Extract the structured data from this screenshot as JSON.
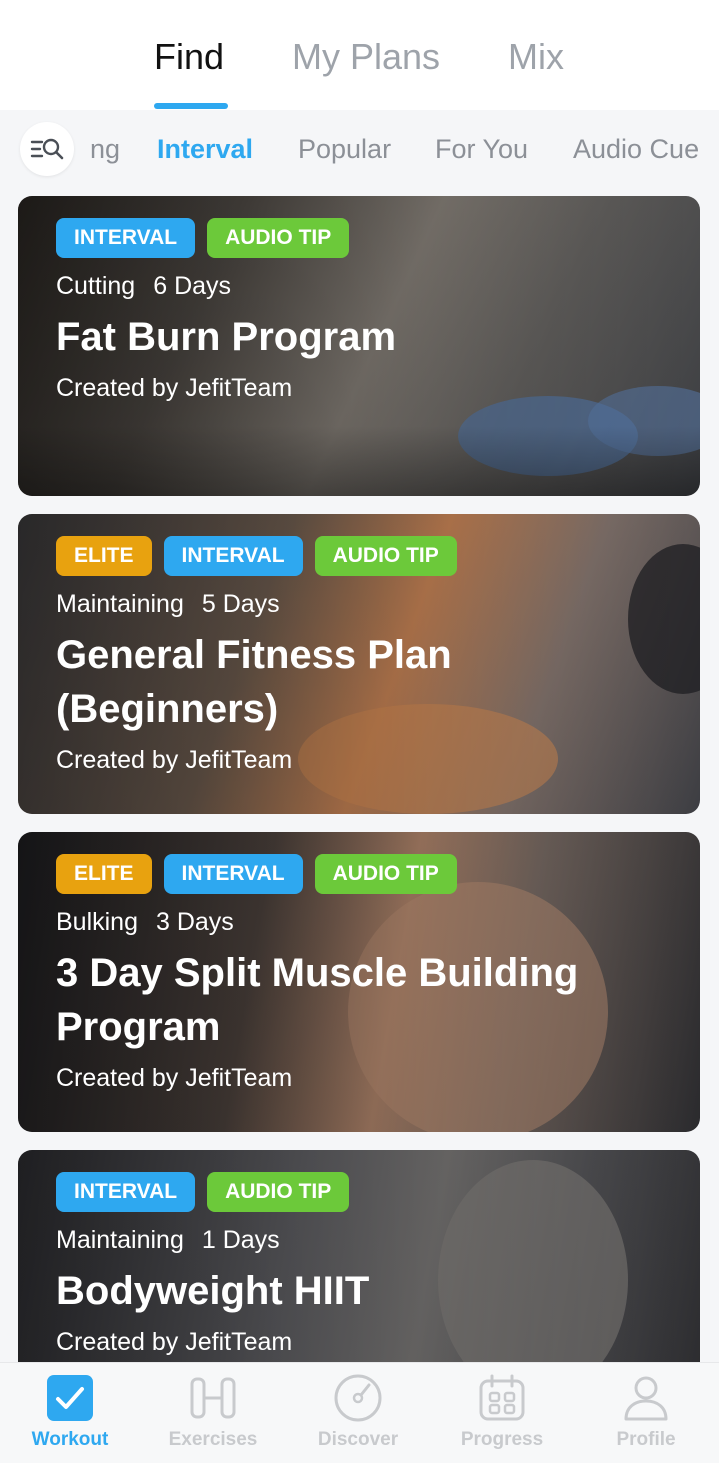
{
  "top_tabs": {
    "find": "Find",
    "my_plans": "My Plans",
    "mix": "Mix",
    "active": "Find"
  },
  "filters": {
    "search_icon": "search-filter-icon",
    "chips": [
      "ng",
      "Interval",
      "Popular",
      "For You",
      "Audio Cue"
    ],
    "active": "Interval"
  },
  "plans": [
    {
      "badges": [
        "INTERVAL",
        "AUDIO TIP"
      ],
      "goal": "Cutting",
      "duration": "6 Days",
      "title": "Fat Burn Program",
      "creator": "Created by JefitTeam"
    },
    {
      "badges": [
        "ELITE",
        "INTERVAL",
        "AUDIO TIP"
      ],
      "goal": "Maintaining",
      "duration": "5 Days",
      "title": "General Fitness Plan (Beginners)",
      "creator": "Created by JefitTeam"
    },
    {
      "badges": [
        "ELITE",
        "INTERVAL",
        "AUDIO TIP"
      ],
      "goal": "Bulking",
      "duration": "3 Days",
      "title": "3 Day Split Muscle Building Program",
      "creator": "Created by JefitTeam"
    },
    {
      "badges": [
        "INTERVAL",
        "AUDIO TIP"
      ],
      "goal": "Maintaining",
      "duration": "1 Days",
      "title": "Bodyweight HIIT",
      "creator": "Created by JefitTeam"
    }
  ],
  "bottom_nav": {
    "items": [
      "Workout",
      "Exercises",
      "Discover",
      "Progress",
      "Profile"
    ],
    "active": "Workout"
  },
  "colors": {
    "accent": "#2ea8f0",
    "interval_badge": "#2ea8f0",
    "audio_badge": "#6cc93a",
    "elite_badge": "#e8a20f",
    "inactive": "#c8cacd"
  }
}
